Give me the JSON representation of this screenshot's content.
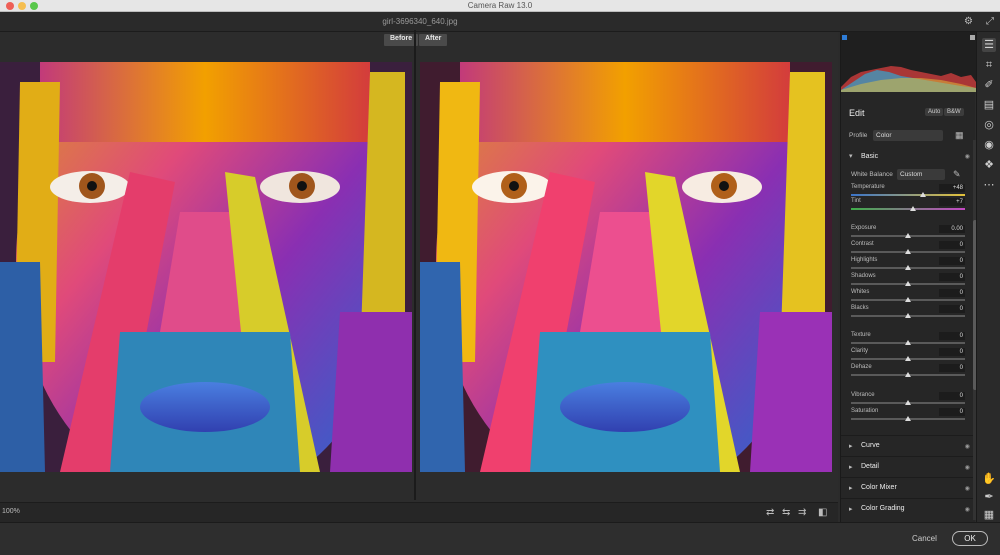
{
  "window": {
    "title": "Camera Raw 13.0"
  },
  "document": {
    "filename": "girl-3696340_640.jpg"
  },
  "view": {
    "before_label": "Before",
    "after_label": "After",
    "zoom": "100%"
  },
  "panel": {
    "edit_title": "Edit",
    "auto_label": "Auto",
    "bw_label": "B&W",
    "profile_label": "Profile",
    "profile_value": "Color",
    "basic": {
      "title": "Basic",
      "white_balance_label": "White Balance",
      "white_balance_value": "Custom",
      "sliders": [
        {
          "label": "Temperature",
          "value": "+48",
          "position": 0.63
        },
        {
          "label": "Tint",
          "value": "+7",
          "position": 0.54
        },
        {
          "label": "Exposure",
          "value": "0.00",
          "position": 0.5
        },
        {
          "label": "Contrast",
          "value": "0",
          "position": 0.5
        },
        {
          "label": "Highlights",
          "value": "0",
          "position": 0.5
        },
        {
          "label": "Shadows",
          "value": "0",
          "position": 0.5
        },
        {
          "label": "Whites",
          "value": "0",
          "position": 0.5
        },
        {
          "label": "Blacks",
          "value": "0",
          "position": 0.5
        },
        {
          "label": "Texture",
          "value": "0",
          "position": 0.5
        },
        {
          "label": "Clarity",
          "value": "0",
          "position": 0.5
        },
        {
          "label": "Dehaze",
          "value": "0",
          "position": 0.5
        },
        {
          "label": "Vibrance",
          "value": "0",
          "position": 0.5
        },
        {
          "label": "Saturation",
          "value": "0",
          "position": 0.5
        }
      ]
    },
    "collapsed_sections": [
      {
        "title": "Curve"
      },
      {
        "title": "Detail"
      },
      {
        "title": "Color Mixer"
      },
      {
        "title": "Color Grading"
      }
    ]
  },
  "footer": {
    "cancel_label": "Cancel",
    "ok_label": "OK"
  },
  "colors": {
    "panel_bg": "#262626",
    "canvas_bg": "#2c2c2c",
    "accent": "#4a90e2"
  },
  "icons": {
    "tools": [
      "edit-sliders-icon",
      "crop-icon",
      "spot-removal-icon",
      "gradient-filter-icon",
      "radial-filter-icon",
      "redeye-icon",
      "presets-icon",
      "more-icon"
    ],
    "bottom_tools": [
      "hand-icon",
      "sampler-icon",
      "grid-icon"
    ]
  }
}
